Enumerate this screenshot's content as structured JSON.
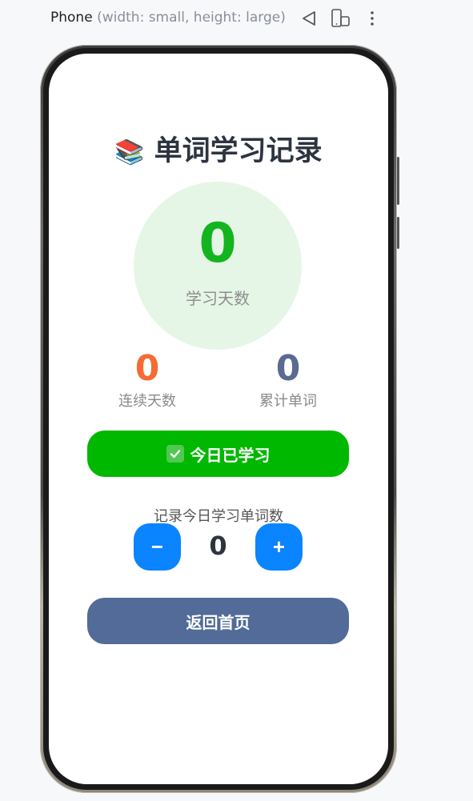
{
  "devtools": {
    "device_name": "Phone",
    "device_dims": "(width: small, height: large)",
    "icons": [
      "back-triangle-icon",
      "rotate-device-icon",
      "more-vert-icon"
    ]
  },
  "app": {
    "title_emoji": "📚",
    "title": "单词学习记录",
    "study_days": {
      "value": "0",
      "label": "学习天数"
    },
    "streak": {
      "value": "0",
      "label": "连续天数"
    },
    "total_words": {
      "value": "0",
      "label": "累计单词"
    },
    "checkin_button": "今日已学习",
    "record_label": "记录今日学习单词数",
    "stepper": {
      "minus": "−",
      "value": "0",
      "plus": "+"
    },
    "home_button": "返回首页"
  },
  "colors": {
    "green_accent": "#14b41f",
    "checkin_bg": "#00b800",
    "circle_bg": "#e6f6e6",
    "streak_color": "#f46b35",
    "total_color": "#5a6a92",
    "stepper_blue": "#0a84ff",
    "home_bg": "#526b98"
  }
}
